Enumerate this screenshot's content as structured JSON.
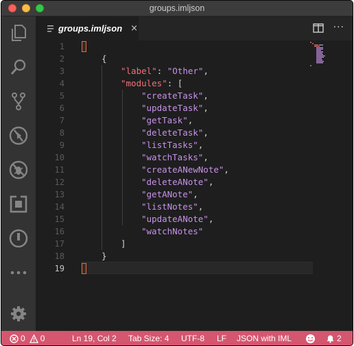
{
  "window": {
    "title": "groups.imljson"
  },
  "activity_bar": {
    "icons": [
      "explorer-icon",
      "search-icon",
      "source-control-icon",
      "debug-icon",
      "extensions-bug-icon",
      "remote-icon",
      "power-icon",
      "more-icon",
      "settings-gear-icon"
    ]
  },
  "tab": {
    "label": "groups.imljson",
    "close_glyph": "×",
    "more_glyph": "···"
  },
  "editor": {
    "line_numbers": [
      "1",
      "2",
      "3",
      "4",
      "5",
      "6",
      "7",
      "8",
      "9",
      "10",
      "11",
      "12",
      "13",
      "14",
      "15",
      "16",
      "17",
      "18",
      "19"
    ],
    "active_line": "19",
    "lines": {
      "l2_brace": "{",
      "l3_key": "\"label\"",
      "l3_colon": ": ",
      "l3_value": "\"Other\"",
      "l3_comma": ",",
      "l4_key": "\"modules\"",
      "l4_rest": ": [",
      "modules": [
        "\"createTask\"",
        "\"updateTask\"",
        "\"getTask\"",
        "\"deleteTask\"",
        "\"listTasks\"",
        "\"watchTasks\"",
        "\"createANewNote\"",
        "\"deleteANote\"",
        "\"getANote\"",
        "\"listNotes\"",
        "\"updateANote\"",
        "\"watchNotes\""
      ],
      "comma": ",",
      "l17_close": "]",
      "l18_close": "}"
    }
  },
  "status_bar": {
    "errors": "0",
    "warnings": "0",
    "position": "Ln 19, Col 2",
    "tab_size": "Tab Size: 4",
    "encoding": "UTF-8",
    "eol": "LF",
    "language": "JSON with IML",
    "notifications": "2",
    "bg_color": "#d5566f"
  }
}
